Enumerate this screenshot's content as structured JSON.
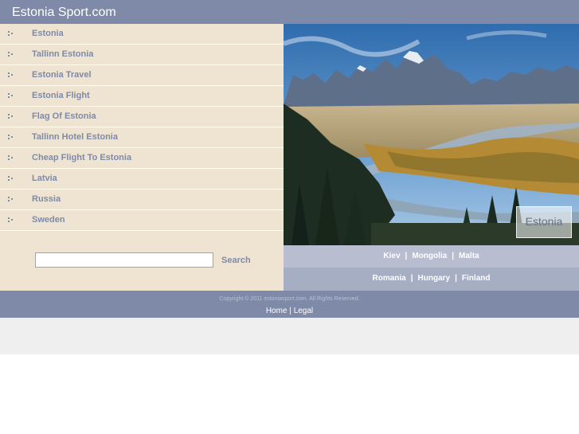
{
  "site": {
    "title": "Estonia Sport.com"
  },
  "sidebar": {
    "items": [
      {
        "label": "Estonia"
      },
      {
        "label": "Tallinn Estonia"
      },
      {
        "label": "Estonia Travel"
      },
      {
        "label": "Estonia Flight"
      },
      {
        "label": "Flag Of Estonia"
      },
      {
        "label": "Tallinn Hotel Estonia"
      },
      {
        "label": "Cheap Flight To Estonia"
      },
      {
        "label": "Latvia"
      },
      {
        "label": "Russia"
      },
      {
        "label": "Sweden"
      }
    ]
  },
  "search": {
    "placeholder": "",
    "value": "",
    "button_label": "Search"
  },
  "hero": {
    "caption": "Estonia"
  },
  "links": {
    "row1": [
      "Kiev",
      "Mongolia",
      "Malta"
    ],
    "row2": [
      "Romania",
      "Hungary",
      "Finland"
    ],
    "separator": "|"
  },
  "footer": {
    "copyright": "Copyright © 2011 estoniasport.com. All Rights Reserved.",
    "home": "Home",
    "separator": "|",
    "legal": "Legal"
  },
  "colors": {
    "header": "#7e8aa8",
    "sidebar": "#efe4d2",
    "link_text": "#7e8aa8",
    "links_row1": "#b8bed0",
    "links_row2": "#a6aec3"
  }
}
